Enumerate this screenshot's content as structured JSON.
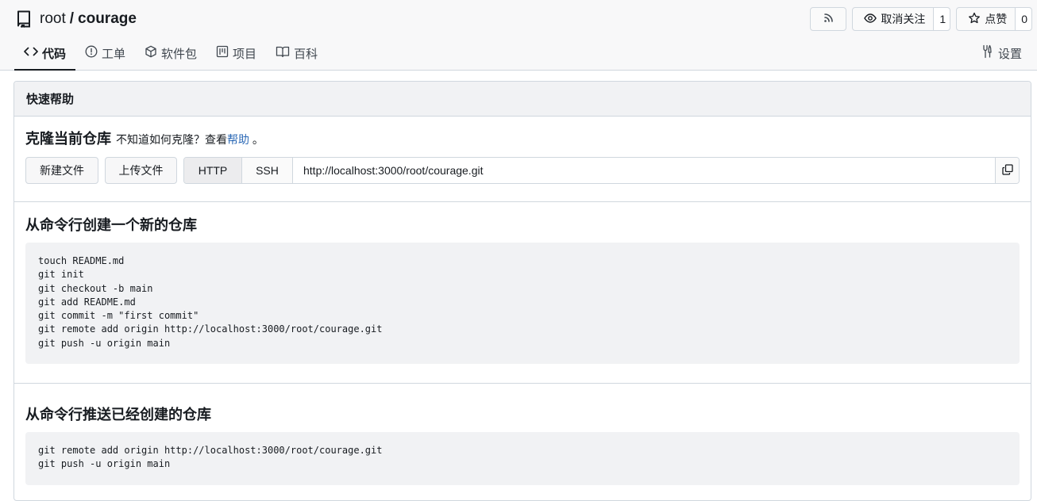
{
  "repo": {
    "owner": "root",
    "separator": "/",
    "name": "courage"
  },
  "actions": {
    "rss_icon": "rss-icon",
    "watch": {
      "label": "取消关注",
      "count": "1",
      "icon": "eye-icon"
    },
    "star": {
      "label": "点赞",
      "count": "0",
      "icon": "star-icon"
    }
  },
  "tabs": [
    {
      "label": "代码",
      "icon": "code-icon",
      "active": true
    },
    {
      "label": "工单",
      "icon": "issue-icon"
    },
    {
      "label": "软件包",
      "icon": "package-icon"
    },
    {
      "label": "项目",
      "icon": "project-icon"
    },
    {
      "label": "百科",
      "icon": "book-icon"
    }
  ],
  "settings": {
    "label": "设置",
    "icon": "tools-icon"
  },
  "quick_help": {
    "title": "快速帮助",
    "clone": {
      "heading": "克隆当前仓库",
      "hint_prefix": "不知道如何克隆？查看",
      "hint_link": "帮助",
      "hint_suffix": " 。",
      "new_file": "新建文件",
      "upload_file": "上传文件",
      "http": "HTTP",
      "ssh": "SSH",
      "url": "http://localhost:3000/root/courage.git"
    },
    "new_repo": {
      "heading": "从命令行创建一个新的仓库",
      "code": "touch README.md\ngit init\ngit checkout -b main\ngit add README.md\ngit commit -m \"first commit\"\ngit remote add origin http://localhost:3000/root/courage.git\ngit push -u origin main"
    },
    "push_existing": {
      "heading": "从命令行推送已经创建的仓库",
      "code": "git remote add origin http://localhost:3000/root/courage.git\ngit push -u origin main"
    }
  },
  "colors": {
    "link": "#2d6ab6",
    "border": "#d0d7de",
    "code_bg": "#f1f2f4"
  }
}
